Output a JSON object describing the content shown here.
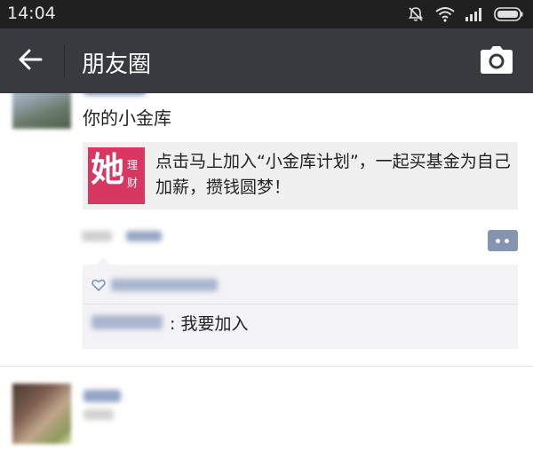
{
  "status_bar": {
    "time": "14:04"
  },
  "header": {
    "title": "朋友圈"
  },
  "icons": {
    "back": "arrow-left-icon",
    "camera": "camera-icon",
    "mute": "bell-muted-icon",
    "wifi": "wifi-icon",
    "signal": "signal-icon",
    "battery": "battery-icon",
    "comment": "comment-dots-icon"
  },
  "feed": {
    "post": {
      "text": "你的小金库",
      "share_card": {
        "thumb_big": "她",
        "thumb_small": "理财",
        "title": "点击马上加入“小金库计划”，一起买基金为自己加薪，攒钱圆梦！"
      },
      "comment": {
        "text": ": 我要加入"
      }
    }
  },
  "colors": {
    "status_bar_bg": "#202020",
    "title_bar_bg": "#393a3f",
    "link_blue": "#576b95",
    "thumb_pink": "#d73760",
    "card_bg": "#f0f0f0"
  }
}
